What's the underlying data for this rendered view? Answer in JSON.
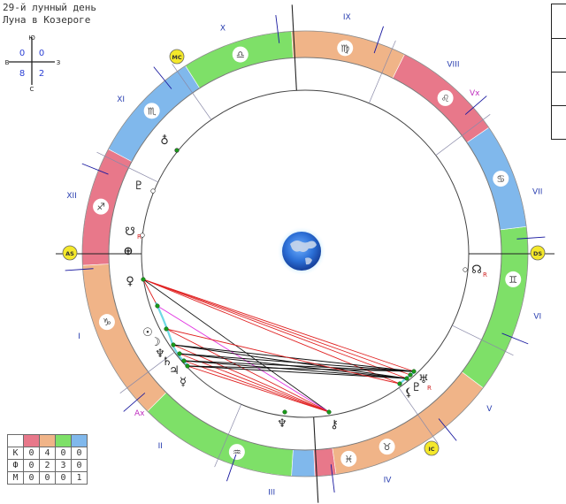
{
  "header": {
    "line1": "29-й лунный день",
    "line2": "Луна в Козероге"
  },
  "compass": {
    "north": "Ю",
    "south": "С",
    "west": "В",
    "east": "З",
    "tl": "0",
    "tr": "0",
    "bl": "8",
    "br": "2"
  },
  "chart": {
    "house_numerals": [
      "I",
      "II",
      "III",
      "IV",
      "V",
      "VI",
      "VII",
      "VIII",
      "IX",
      "X",
      "XI",
      "XII"
    ],
    "angles": {
      "asc": "AS",
      "mc": "MC",
      "dsc": "DS",
      "ic": "IC"
    },
    "points": {
      "vertex": "Vx",
      "antivertex": "Ax",
      "retro": "R"
    },
    "zodiac": [
      {
        "sign": "aries",
        "glyph": "♈",
        "color": "#e8788a"
      },
      {
        "sign": "taurus",
        "glyph": "♉",
        "color": "#f0b488"
      },
      {
        "sign": "gemini",
        "glyph": "♊",
        "color": "#7ee068"
      },
      {
        "sign": "cancer",
        "glyph": "♋",
        "color": "#80b8ec"
      },
      {
        "sign": "leo",
        "glyph": "♌",
        "color": "#e8788a"
      },
      {
        "sign": "virgo",
        "glyph": "♍",
        "color": "#f0b488"
      },
      {
        "sign": "libra",
        "glyph": "♎",
        "color": "#7ee068"
      },
      {
        "sign": "scorpio",
        "glyph": "♏",
        "color": "#80b8ec"
      },
      {
        "sign": "sagittarius",
        "glyph": "♐",
        "color": "#e8788a"
      },
      {
        "sign": "capricorn",
        "glyph": "♑",
        "color": "#f0b488"
      },
      {
        "sign": "aquarius",
        "glyph": "♒",
        "color": "#7ee068"
      },
      {
        "sign": "pisces",
        "glyph": "♓",
        "color": "#80b8ec"
      }
    ],
    "planets": [
      {
        "name": "venus",
        "glyph": "♀"
      },
      {
        "name": "sun",
        "glyph": "☉"
      },
      {
        "name": "moon",
        "glyph": "☽"
      },
      {
        "name": "neptune",
        "glyph": "♆"
      },
      {
        "name": "saturn",
        "glyph": "♄"
      },
      {
        "name": "jupiter",
        "glyph": "♃"
      },
      {
        "name": "mercury",
        "glyph": "☿"
      },
      {
        "name": "mars",
        "glyph": "♂"
      },
      {
        "name": "uranus",
        "glyph": "♅"
      },
      {
        "name": "pluto",
        "glyph": "♇"
      },
      {
        "name": "lilith",
        "glyph": "⚸"
      },
      {
        "name": "chiron",
        "glyph": "⚷"
      },
      {
        "name": "south-node",
        "glyph": "☋"
      },
      {
        "name": "north-node",
        "glyph": "☊"
      },
      {
        "name": "fortune",
        "glyph": "⊕"
      },
      {
        "name": "neptune-2",
        "glyph": "♆"
      },
      {
        "name": "earth",
        "glyph": "♁"
      }
    ],
    "colors": {
      "aspect_red": "#e02020",
      "aspect_black": "#111111",
      "aspect_magenta": "#e030e0",
      "house_line": "#1a1aa0",
      "angle_badge": "#f4e82a"
    }
  },
  "aspect_table": {
    "header_colors": [
      "#e8788a",
      "#f0b488",
      "#7ee068",
      "#80b8ec"
    ],
    "rows": [
      {
        "label": "К",
        "values": [
          "0",
          "4",
          "0",
          "0"
        ]
      },
      {
        "label": "Ф",
        "values": [
          "0",
          "2",
          "3",
          "0"
        ]
      },
      {
        "label": "М",
        "values": [
          "0",
          "0",
          "0",
          "1"
        ]
      }
    ]
  }
}
